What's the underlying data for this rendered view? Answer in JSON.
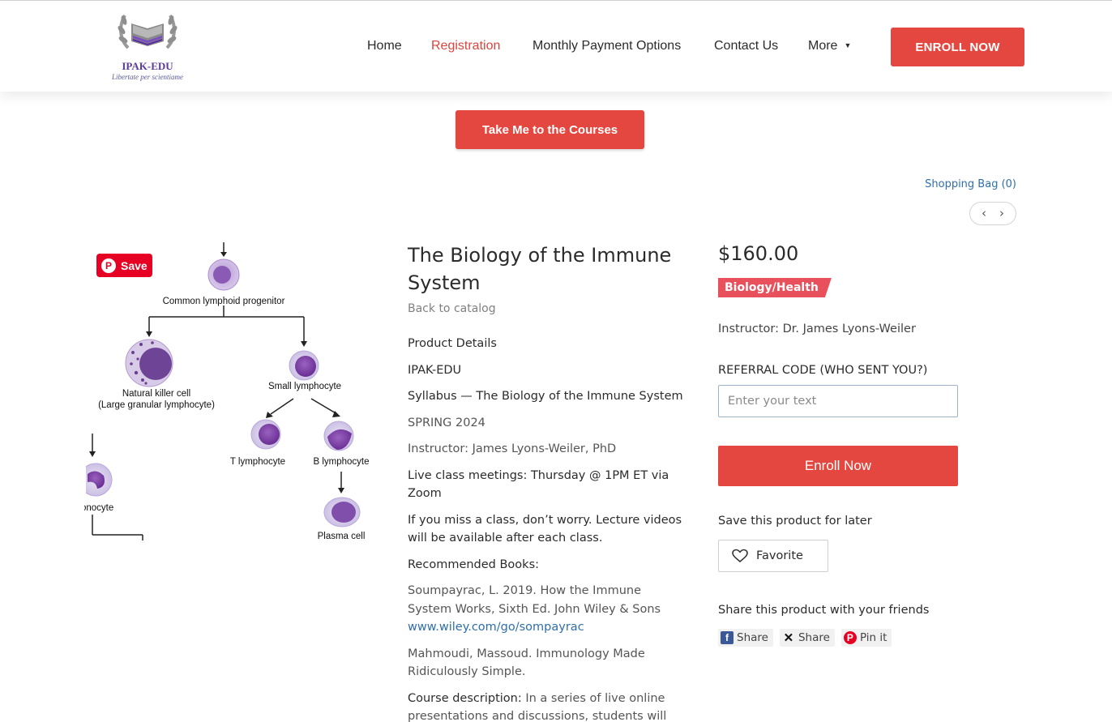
{
  "header": {
    "logo_title": "IPAK-EDU",
    "logo_motto": "Libertate per scientiame",
    "nav": [
      {
        "label": "Home"
      },
      {
        "label": "Registration",
        "active": true
      },
      {
        "label": "Monthly Payment Options"
      },
      {
        "label": "Contact Us"
      },
      {
        "label": "More"
      }
    ],
    "enroll_button": "ENROLL NOW"
  },
  "courses_button": "Take Me to the Courses",
  "shopping_bag": "Shopping Bag (0)",
  "pager": {
    "prev_icon": "chevron-left-icon",
    "next_icon": "chevron-right-icon"
  },
  "image": {
    "pinterest_save": "Save",
    "labels": {
      "common": "Common lymphoid progenitor",
      "nk1": "Natural killer cell",
      "nk2": "(Large granular lymphocyte)",
      "small": "Small lymphocyte",
      "t": "T lymphocyte",
      "b": "B lymphocyte",
      "mono": "onocyte",
      "plasma": "Plasma cell"
    }
  },
  "product": {
    "title": "The Biology of the Immune System",
    "back_link": "Back to catalog",
    "details": {
      "heading": "Product Details",
      "org": "IPAK-EDU",
      "syllabus": "Syllabus — The Biology of the Immune System",
      "term": "SPRING 2024",
      "instructor": "Instructor: James Lyons-Weiler, PhD",
      "live": "Live class meetings: Thursday @ 1PM ET via Zoom",
      "miss": "If you miss a class, don’t worry. Lecture videos will be available after each class.",
      "books_heading": "Recommended Books:",
      "book1": "Soumpayrac, L. 2019. How the Immune System Works, Sixth Ed. John Wiley & Sons",
      "book1_link": "www.wiley.com/go/sompayrac",
      "book2": "Mahmoudi, Massoud. Immunology Made Ridiculously Simple.",
      "desc_label": "Course description:",
      "desc_text": " In a series of live online presentations and discussions, students will"
    },
    "price": "$160.00",
    "category": "Biology/Health",
    "instructor": "Instructor: Dr. James Lyons-Weiler",
    "referral_label": "REFERRAL CODE (WHO SENT YOU?)",
    "referral_placeholder": "Enter your text",
    "enroll_button": "Enroll Now",
    "save_later": "Save this product for later",
    "favorite": "Favorite",
    "share_label": "Share this product with your friends",
    "share": {
      "facebook": "Share",
      "x": "Share",
      "pinterest": "Pin it"
    }
  },
  "colors": {
    "accent": "#e3473f",
    "link": "#2f6fa8",
    "badge": "#e8505b"
  }
}
